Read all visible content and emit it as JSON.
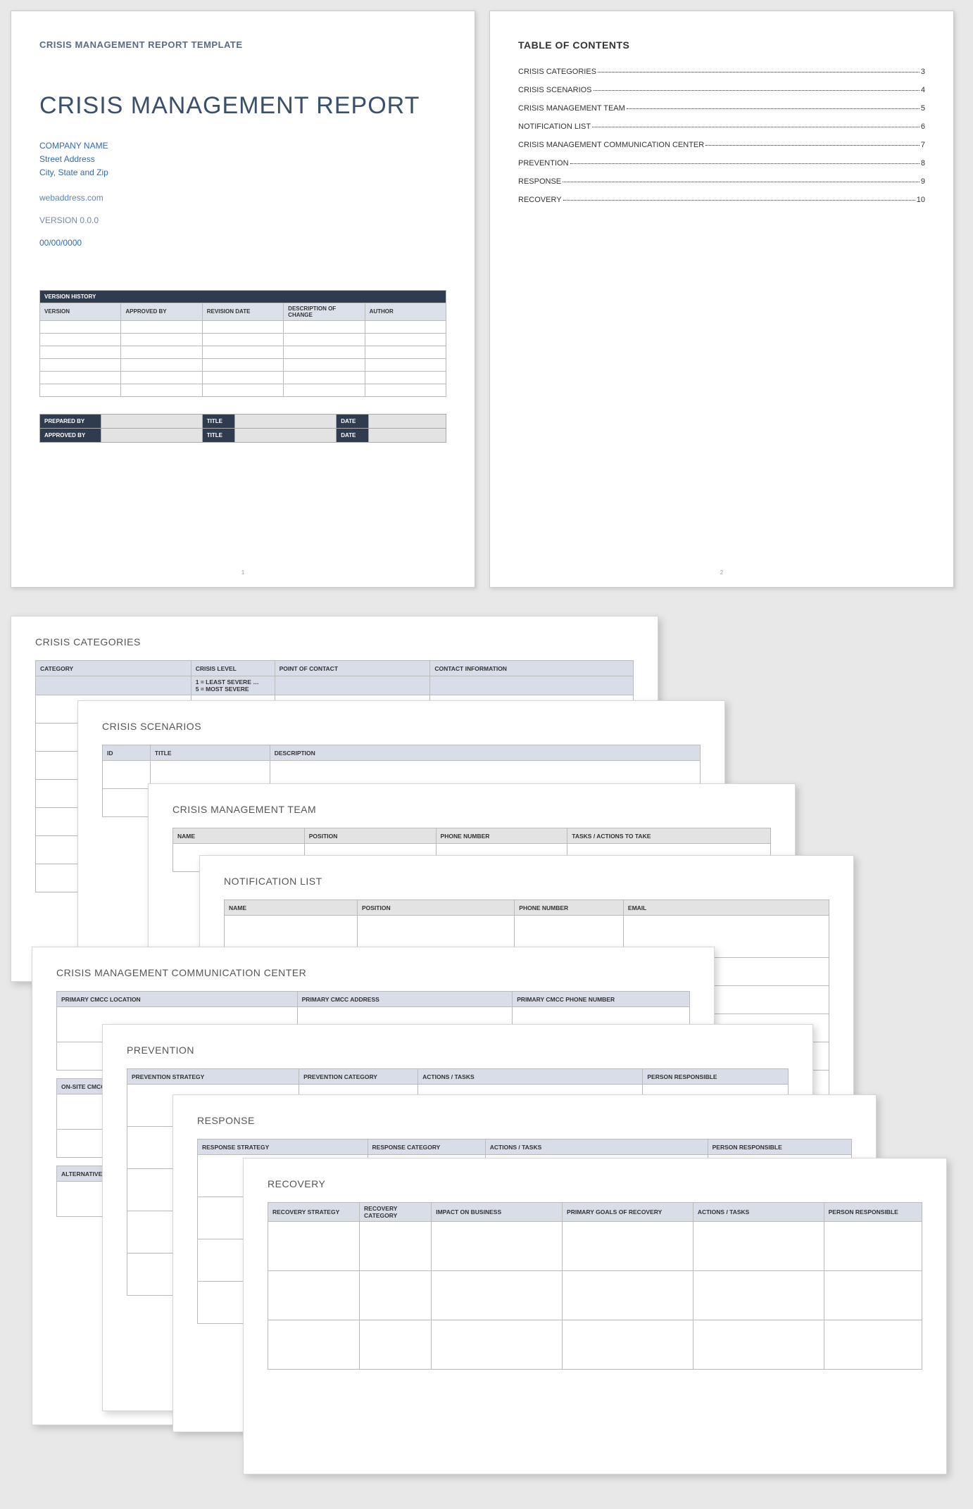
{
  "page1": {
    "template_header": "CRISIS MANAGEMENT REPORT TEMPLATE",
    "title": "CRISIS MANAGEMENT REPORT",
    "company": "COMPANY NAME",
    "street": "Street Address",
    "city": "City, State and Zip",
    "web": "webaddress.com",
    "version": "VERSION 0.0.0",
    "date": "00/00/0000",
    "vh_title": "VERSION HISTORY",
    "vh_cols": {
      "c1": "VERSION",
      "c2": "APPROVED BY",
      "c3": "REVISION DATE",
      "c4": "DESCRIPTION OF CHANGE",
      "c5": "AUTHOR"
    },
    "sign": {
      "prepared": "PREPARED BY",
      "approved": "APPROVED BY",
      "title": "TITLE",
      "date": "DATE"
    },
    "page_num": "1"
  },
  "page2": {
    "toc_title": "TABLE OF CONTENTS",
    "items": [
      {
        "label": "CRISIS CATEGORIES",
        "pg": "3"
      },
      {
        "label": "CRISIS SCENARIOS",
        "pg": "4"
      },
      {
        "label": "CRISIS MANAGEMENT TEAM",
        "pg": "5"
      },
      {
        "label": "NOTIFICATION LIST",
        "pg": "6"
      },
      {
        "label": "CRISIS MANAGEMENT COMMUNICATION CENTER",
        "pg": "7"
      },
      {
        "label": "PREVENTION",
        "pg": "8"
      },
      {
        "label": "RESPONSE",
        "pg": "9"
      },
      {
        "label": "RECOVERY",
        "pg": "10"
      }
    ],
    "page_num": "2"
  },
  "cat": {
    "heading": "CRISIS CATEGORIES",
    "cols": {
      "c1": "CATEGORY",
      "c2": "CRISIS LEVEL",
      "c3": "POINT OF CONTACT",
      "c4": "CONTACT INFORMATION"
    },
    "sub": {
      "least": "1 = LEAST SEVERE …",
      "most": "5 = MOST SEVERE"
    }
  },
  "scen": {
    "heading": "CRISIS SCENARIOS",
    "cols": {
      "c1": "ID",
      "c2": "TITLE",
      "c3": "DESCRIPTION"
    }
  },
  "team": {
    "heading": "CRISIS MANAGEMENT TEAM",
    "cols": {
      "c1": "NAME",
      "c2": "POSITION",
      "c3": "PHONE NUMBER",
      "c4": "TASKS / ACTIONS TO TAKE"
    }
  },
  "notif": {
    "heading": "NOTIFICATION LIST",
    "cols": {
      "c1": "NAME",
      "c2": "POSITION",
      "c3": "PHONE NUMBER",
      "c4": "EMAIL"
    }
  },
  "cmcc": {
    "heading": "CRISIS MANAGEMENT COMMUNICATION CENTER",
    "row1": {
      "c1": "PRIMARY CMCC LOCATION",
      "c2": "PRIMARY CMCC ADDRESS",
      "c3": "PRIMARY CMCC PHONE NUMBER"
    },
    "row2": "ON-SITE CMCC LOCATION",
    "row3": "ALTERNATIVE CMCC LOCATION"
  },
  "prev": {
    "heading": "PREVENTION",
    "cols": {
      "c1": "PREVENTION STRATEGY",
      "c2": "PREVENTION CATEGORY",
      "c3": "ACTIONS / TASKS",
      "c4": "PERSON RESPONSIBLE"
    }
  },
  "resp": {
    "heading": "RESPONSE",
    "cols": {
      "c1": "RESPONSE STRATEGY",
      "c2": "RESPONSE CATEGORY",
      "c3": "ACTIONS / TASKS",
      "c4": "PERSON RESPONSIBLE"
    }
  },
  "rec": {
    "heading": "RECOVERY",
    "cols": {
      "c1": "RECOVERY STRATEGY",
      "c2": "RECOVERY CATEGORY",
      "c3": "IMPACT ON BUSINESS",
      "c4": "PRIMARY GOALS OF RECOVERY",
      "c5": "ACTIONS / TASKS",
      "c6": "PERSON RESPONSIBLE"
    }
  }
}
